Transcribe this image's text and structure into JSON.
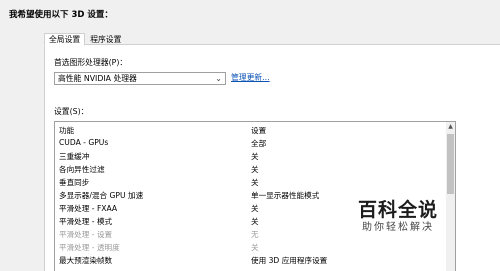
{
  "title": "我希望使用以下 3D 设置：",
  "tabs": [
    {
      "label": "全局设置",
      "active": true
    },
    {
      "label": "程序设置",
      "active": false
    }
  ],
  "gpu": {
    "label": "首选图形处理器(P)：",
    "selected": "高性能 NVIDIA 处理器",
    "restore_link": "管理更新..."
  },
  "settings_label": "设置(S)：",
  "table": {
    "headers": [
      "功能",
      "设置"
    ],
    "rows": [
      {
        "feature": "CUDA - GPUs",
        "value": "全部",
        "disabled": false
      },
      {
        "feature": "三重缓冲",
        "value": "关",
        "disabled": false
      },
      {
        "feature": "各向异性过滤",
        "value": "关",
        "disabled": false
      },
      {
        "feature": "垂直同步",
        "value": "关",
        "disabled": false
      },
      {
        "feature": "多显示器/混合 GPU 加速",
        "value": "单一显示器性能模式",
        "disabled": false
      },
      {
        "feature": "平滑处理 - FXAA",
        "value": "关",
        "disabled": false
      },
      {
        "feature": "平滑处理 - 模式",
        "value": "关",
        "disabled": false
      },
      {
        "feature": "平滑处理 - 设置",
        "value": "无",
        "disabled": true
      },
      {
        "feature": "平滑处理 - 透明度",
        "value": "关",
        "disabled": true
      },
      {
        "feature": "最大预渲染帧数",
        "value": "使用 3D 应用程序设置",
        "disabled": false
      }
    ]
  },
  "watermark": {
    "main": "百科全说",
    "sub": "助你轻松解决"
  }
}
